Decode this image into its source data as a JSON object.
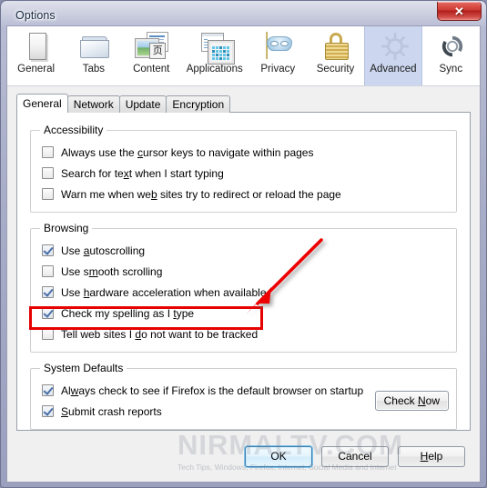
{
  "window": {
    "title": "Options",
    "close_label": "✕"
  },
  "categories": [
    {
      "label": "General",
      "icon": "general-page-icon",
      "selected": false
    },
    {
      "label": "Tabs",
      "icon": "folder-icon",
      "selected": false
    },
    {
      "label": "Content",
      "icon": "content-page-icon",
      "selected": false
    },
    {
      "label": "Applications",
      "icon": "applications-icon",
      "selected": false
    },
    {
      "label": "Privacy",
      "icon": "mask-icon",
      "selected": false
    },
    {
      "label": "Security",
      "icon": "padlock-icon",
      "selected": false
    },
    {
      "label": "Advanced",
      "icon": "gear-icon",
      "selected": true
    },
    {
      "label": "Sync",
      "icon": "sync-arrows-icon",
      "selected": false
    }
  ],
  "tabs": [
    {
      "label": "General",
      "active": true
    },
    {
      "label": "Network",
      "active": false
    },
    {
      "label": "Update",
      "active": false
    },
    {
      "label": "Encryption",
      "active": false
    }
  ],
  "groups": [
    {
      "legend": "Accessibility",
      "options": [
        {
          "pre": "Always use the ",
          "accel": "c",
          "post": "ursor keys to navigate within pages",
          "checked": false
        },
        {
          "pre": "Search for te",
          "accel": "x",
          "post": "t when I start typing",
          "checked": false
        },
        {
          "pre": "Warn me when we",
          "accel": "b",
          "post": " sites try to redirect or reload the page",
          "checked": false
        }
      ]
    },
    {
      "legend": "Browsing",
      "options": [
        {
          "pre": "Use ",
          "accel": "a",
          "post": "utoscrolling",
          "checked": true
        },
        {
          "pre": "Use s",
          "accel": "m",
          "post": "ooth scrolling",
          "checked": false
        },
        {
          "pre": "Use ",
          "accel": "h",
          "post": "ardware acceleration when available",
          "checked": true
        },
        {
          "pre": "Check my spelling as I ",
          "accel": "t",
          "post": "ype",
          "checked": true
        },
        {
          "pre": "Tell web sites I ",
          "accel": "d",
          "post": "o not want to be tracked",
          "checked": false,
          "highlighted": true
        }
      ]
    },
    {
      "legend": "System Defaults",
      "options": [
        {
          "pre": "Al",
          "accel": "w",
          "post": "ays check to see if Firefox is the default browser on startup",
          "checked": true
        },
        {
          "pre": "",
          "accel": "S",
          "post": "ubmit crash reports",
          "checked": true
        }
      ],
      "button": {
        "pre": "Check ",
        "accel": "N",
        "post": "ow"
      }
    }
  ],
  "dialog_buttons": [
    {
      "pre": "",
      "accel": "",
      "post": "OK",
      "default": true
    },
    {
      "pre": "",
      "accel": "",
      "post": "Cancel",
      "default": false
    },
    {
      "pre": "",
      "accel": "H",
      "post": "elp",
      "default": false
    }
  ],
  "watermark": {
    "main": "NIRMALTV.COM",
    "sub": "Tech Tips, Windows, Firefox, Internet, Social Media and Internet"
  },
  "annotation": {
    "box_color": "#e60000",
    "arrow_color": "#ee0000"
  }
}
